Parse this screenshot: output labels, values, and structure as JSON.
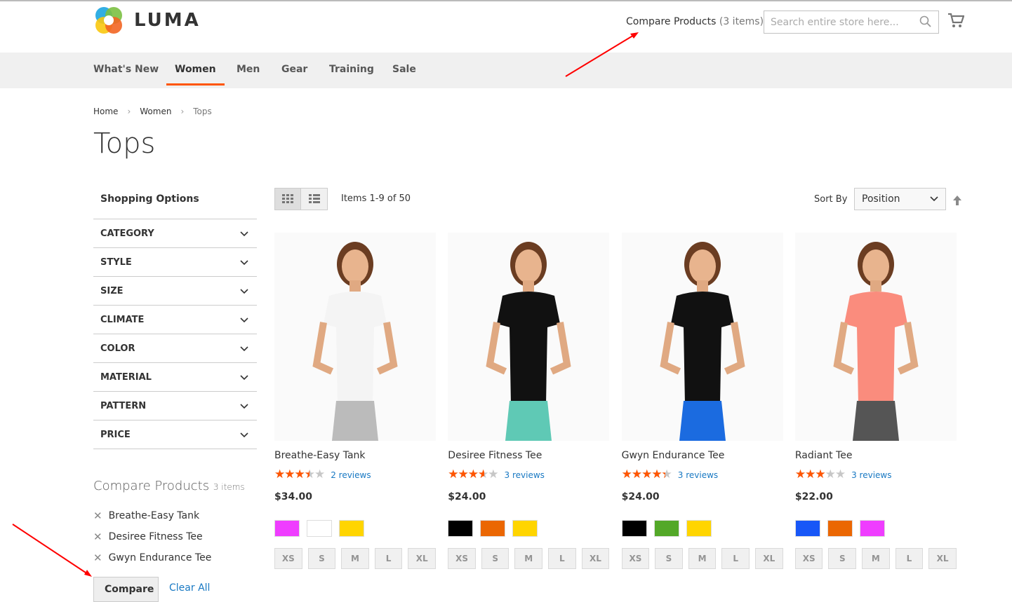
{
  "header": {
    "logo": "LUMA",
    "compare_link": "Compare Products",
    "compare_count": "(3 items)",
    "search_placeholder": "Search entire store here..."
  },
  "nav": [
    "What's New",
    "Women",
    "Men",
    "Gear",
    "Training",
    "Sale"
  ],
  "breadcrumb": [
    "Home",
    "Women",
    "Tops"
  ],
  "page_title": "Tops",
  "sidebar": {
    "title": "Shopping Options",
    "filters": [
      "CATEGORY",
      "STYLE",
      "SIZE",
      "CLIMATE",
      "COLOR",
      "MATERIAL",
      "PATTERN",
      "PRICE"
    ],
    "compare": {
      "title": "Compare Products",
      "count": "3 items",
      "items": [
        "Breathe-Easy Tank",
        "Desiree Fitness Tee",
        "Gwyn Endurance Tee"
      ],
      "compare_button": "Compare",
      "clear_all": "Clear All"
    }
  },
  "toolbar": {
    "amount": "Items 1-9 of 50",
    "sort_label": "Sort By",
    "sort_value": "Position"
  },
  "accent": "#ff5501",
  "products": [
    {
      "name": "Breathe-Easy Tank",
      "rating_pct": 70,
      "reviews": "2 reviews",
      "price": "$34.00",
      "colors": [
        "#ef3dff",
        "#ffffff",
        "#ffd500"
      ],
      "shirt": "#f4f4f4",
      "bottom": "#bbbbbb",
      "sizes": [
        "XS",
        "S",
        "M",
        "L",
        "XL"
      ]
    },
    {
      "name": "Desiree Fitness Tee",
      "rating_pct": 73,
      "reviews": "3 reviews",
      "price": "$24.00",
      "colors": [
        "#000000",
        "#eb6703",
        "#ffd500"
      ],
      "shirt": "#111111",
      "bottom": "#5fc9b5",
      "sizes": [
        "XS",
        "S",
        "M",
        "L",
        "XL"
      ]
    },
    {
      "name": "Gwyn Endurance Tee",
      "rating_pct": 87,
      "reviews": "3 reviews",
      "price": "$24.00",
      "colors": [
        "#000000",
        "#53a828",
        "#ffd500"
      ],
      "shirt": "#111111",
      "bottom": "#1b6be0",
      "sizes": [
        "XS",
        "S",
        "M",
        "L",
        "XL"
      ]
    },
    {
      "name": "Radiant Tee",
      "rating_pct": 60,
      "reviews": "3 reviews",
      "price": "$22.00",
      "colors": [
        "#1857f7",
        "#eb6703",
        "#ef3dff"
      ],
      "shirt": "#fa8c7d",
      "bottom": "#555555",
      "sizes": [
        "XS",
        "S",
        "M",
        "L",
        "XL"
      ]
    }
  ]
}
